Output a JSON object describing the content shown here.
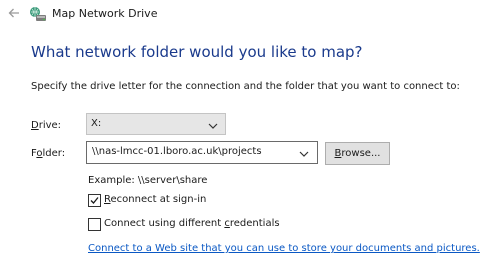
{
  "window": {
    "title": "Map Network Drive",
    "back_icon": "back-arrow-icon",
    "app_icon": "network-drive-icon"
  },
  "main": {
    "heading": "What network folder would you like to map?",
    "instructions": "Specify the drive letter for the connection and the folder that you want to connect to:",
    "drive": {
      "label_accel": "D",
      "label_rest": "rive:",
      "value": "X:"
    },
    "folder": {
      "label_pre": "F",
      "label_accel": "o",
      "label_rest": "lder:",
      "value": "\\\\nas-lmcc-01.lboro.ac.uk\\projects"
    },
    "browse": {
      "accel": "B",
      "rest": "rowse..."
    },
    "example": "Example: \\\\server\\share",
    "reconnect": {
      "checked": true,
      "accel": "R",
      "rest": "econnect at sign-in"
    },
    "different_credentials": {
      "checked": false,
      "pre": "Connect using different ",
      "accel": "c",
      "rest": "redentials"
    },
    "link_text": "Connect to a Web site that you can use to store your documents and pictures."
  }
}
